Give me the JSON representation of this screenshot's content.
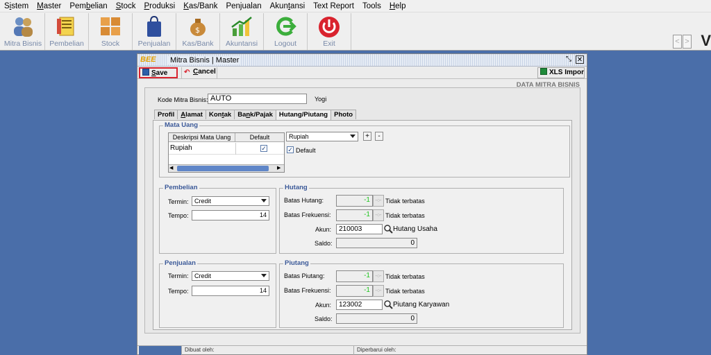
{
  "menu": [
    {
      "pre": "S",
      "u": "i",
      "post": "stem"
    },
    {
      "pre": "",
      "u": "M",
      "post": "aster"
    },
    {
      "pre": "Pem",
      "u": "b",
      "post": "elian"
    },
    {
      "pre": "",
      "u": "S",
      "post": "tock"
    },
    {
      "pre": "",
      "u": "P",
      "post": "roduksi"
    },
    {
      "pre": "",
      "u": "K",
      "post": "as/Bank"
    },
    {
      "pre": "Pen",
      "u": "j",
      "post": "ualan"
    },
    {
      "pre": "Akun",
      "u": "t",
      "post": "ansi"
    },
    {
      "pre": "Text Report",
      "u": "",
      "post": ""
    },
    {
      "pre": "Tools",
      "u": "",
      "post": ""
    },
    {
      "pre": "",
      "u": "H",
      "post": "elp"
    }
  ],
  "toolbar": {
    "items": [
      "Mitra Bisnis",
      "Pembelian",
      "Stock",
      "Penjualan",
      "Kas/Bank",
      "Akuntansi",
      "Logout",
      "Exit"
    ],
    "nav_prev": "<",
    "nav_next": ">",
    "right_letter": "V"
  },
  "window": {
    "logo": "BEE",
    "title": "Mitra Bisnis | Master",
    "save_u": "S",
    "save_rest": "ave",
    "cancel_u": "C",
    "cancel_rest": "ancel",
    "xls": "XLS Impor",
    "page_header": "DATA MITRA BISNIS"
  },
  "form": {
    "kode_label": "Kode Mitra Bisnis:",
    "kode_value": "AUTO",
    "name_value": "Yogi"
  },
  "tabs": [
    "Profil",
    "Alamat",
    "Kontak",
    "Bank/Pajak",
    "Hutang/Piutang",
    "Photo"
  ],
  "active_tab": "Hutang/Piutang",
  "mata_uang": {
    "title": "Mata Uang",
    "col_desc": "Deskripsi Mata Uang",
    "col_default": "Default",
    "row_desc": "Rupiah",
    "row_default": true,
    "select_value": "Rupiah",
    "add": "+",
    "remove": "-",
    "default_label": "Default"
  },
  "pembelian": {
    "title": "Pembelian",
    "termin_label": "Termin:",
    "termin_value": "Credit",
    "tempo_label": "Tempo:",
    "tempo_value": "14"
  },
  "hutang": {
    "title": "Hutang",
    "batas_label": "Batas Hutang:",
    "batas_value": "-1",
    "batas_note": "Tidak terbatas",
    "frek_label": "Batas Frekuensi:",
    "frek_value": "-1",
    "frek_note": "Tidak terbatas",
    "akun_label": "Akun:",
    "akun_value": "210003",
    "akun_name": "Hutang Usaha",
    "saldo_label": "Saldo:",
    "saldo_value": "0"
  },
  "penjualan": {
    "title": "Penjualan",
    "termin_label": "Termin:",
    "termin_value": "Credit",
    "tempo_label": "Tempo:",
    "tempo_value": "14"
  },
  "piutang": {
    "title": "Piutang",
    "batas_label": "Batas Piutang:",
    "batas_value": "-1",
    "batas_note": "Tidak terbatas",
    "frek_label": "Batas Frekuensi:",
    "frek_value": "-1",
    "frek_note": "Tidak terbatas",
    "akun_label": "Akun:",
    "akun_value": "123002",
    "akun_name": "Piutang Karyawan",
    "saldo_label": "Saldo:",
    "saldo_value": "0"
  },
  "status": {
    "dibuat": "Dibuat oleh:",
    "diperbarui": "Diperbarui oleh:"
  },
  "colors": {
    "desktop": "#4a6ea9",
    "save_highlight": "#d9232e",
    "group_title": "#3b5998",
    "limit_value": "#1ec41e"
  },
  "icons": [
    "users-icon",
    "ledger-icon",
    "boxes-icon",
    "shopping-bag-icon",
    "money-bag-icon",
    "chart-up-icon",
    "logout-arrow-icon",
    "power-icon"
  ]
}
